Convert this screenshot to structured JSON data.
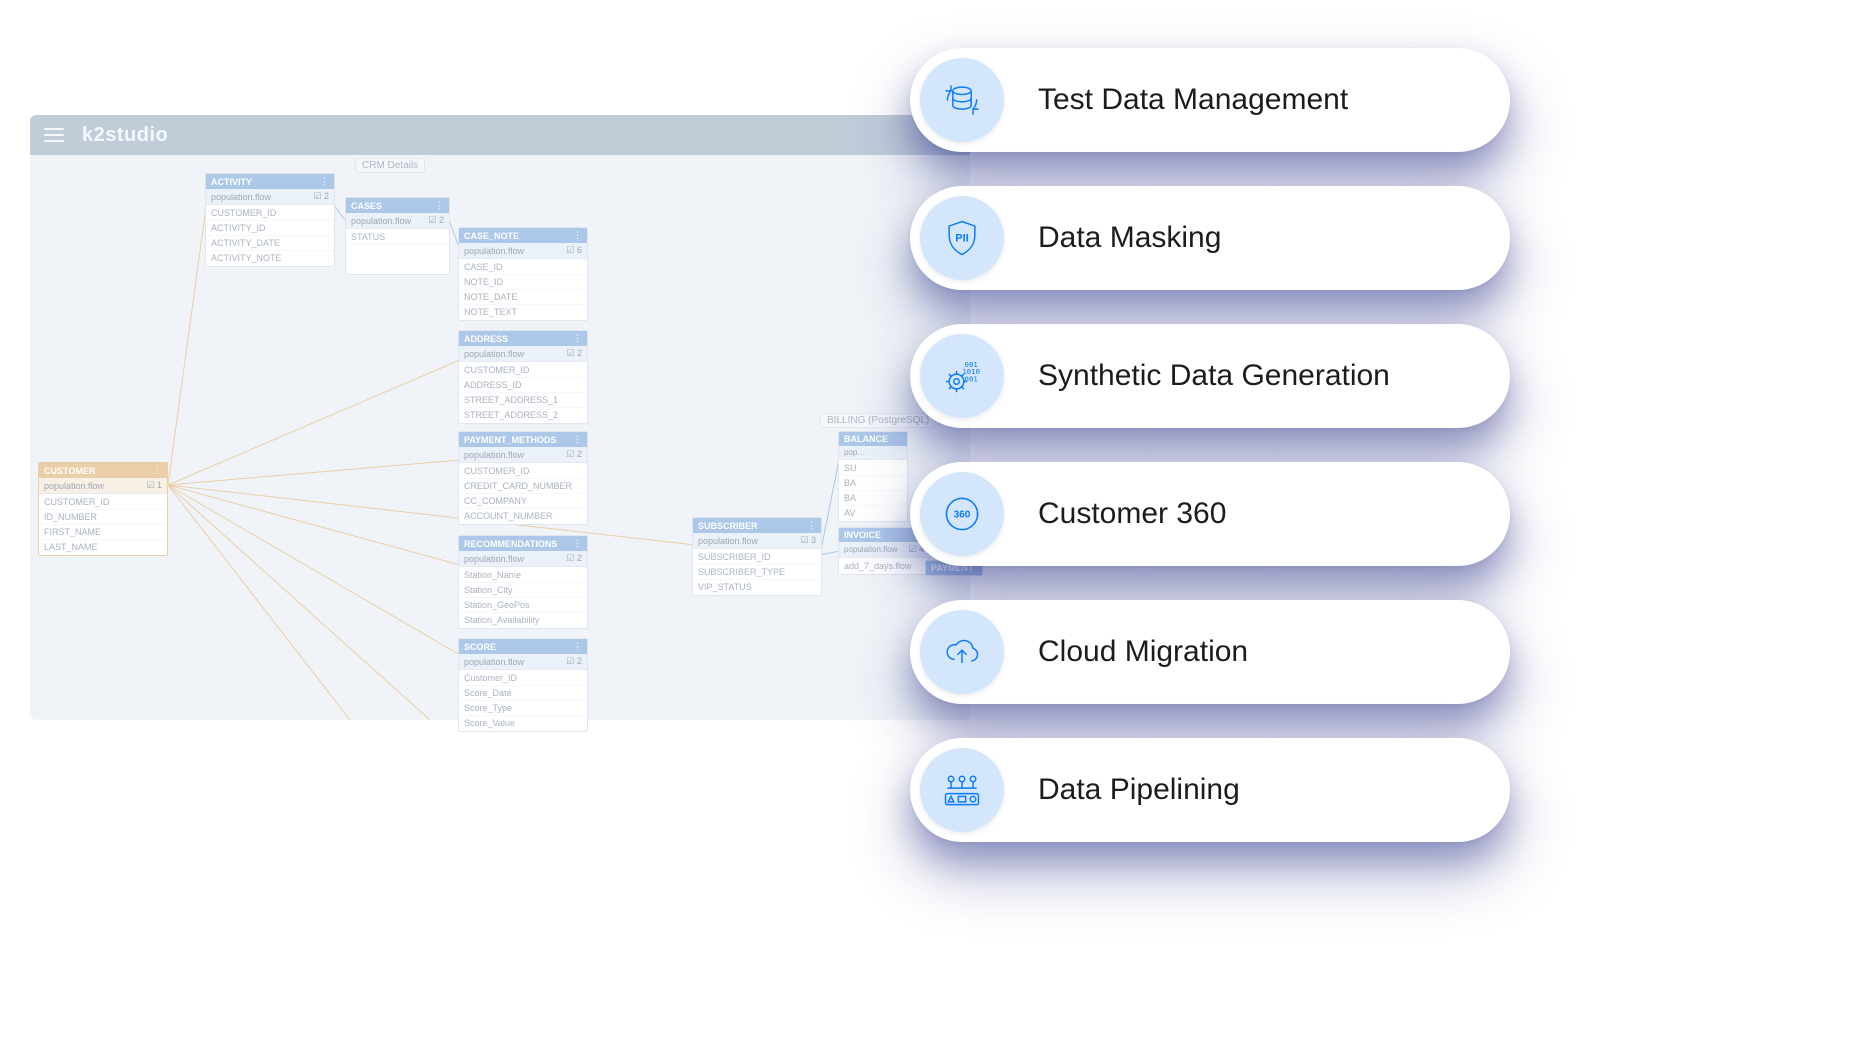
{
  "studio": {
    "logo": "k2studio",
    "canvas_tags": {
      "crm": "CRM Details",
      "billing": "BILLING (PostgreSQL)"
    },
    "population_flow_label": "population.flow",
    "entities": {
      "customer": {
        "title": "CUSTOMER",
        "count": "1",
        "fields": [
          "CUSTOMER_ID",
          "ID_NUMBER",
          "FIRST_NAME",
          "LAST_NAME"
        ]
      },
      "activity": {
        "title": "ACTIVITY",
        "count": "2",
        "fields": [
          "CUSTOMER_ID",
          "ACTIVITY_ID",
          "ACTIVITY_DATE",
          "ACTIVITY_NOTE"
        ]
      },
      "cases": {
        "title": "CASES",
        "count": "2",
        "fields": [
          "STATUS"
        ]
      },
      "case_note": {
        "title": "CASE_NOTE",
        "count": "6",
        "fields": [
          "CASE_ID",
          "NOTE_ID",
          "NOTE_DATE",
          "NOTE_TEXT"
        ]
      },
      "address": {
        "title": "ADDRESS",
        "count": "2",
        "fields": [
          "CUSTOMER_ID",
          "ADDRESS_ID",
          "STREET_ADDRESS_1",
          "STREET_ADDRESS_2"
        ]
      },
      "payment": {
        "title": "PAYMENT_METHODS",
        "count": "2",
        "fields": [
          "CUSTOMER_ID",
          "CREDIT_CARD_NUMBER",
          "CC_COMPANY",
          "ACCOUNT_NUMBER"
        ]
      },
      "recs": {
        "title": "RECOMMENDATIONS",
        "count": "2",
        "fields": [
          "Station_Name",
          "Station_City",
          "Station_GeoPos",
          "Station_Availability"
        ]
      },
      "score": {
        "title": "SCORE",
        "count": "2",
        "fields": [
          "Customer_ID",
          "Score_Date",
          "Score_Type",
          "Score_Value"
        ]
      },
      "subscriber": {
        "title": "SUBSCRIBER",
        "count": "3",
        "fields": [
          "SUBSCRIBER_ID",
          "SUBSCRIBER_TYPE",
          "VIP_STATUS"
        ]
      },
      "balance": {
        "title": "BALANCE",
        "count": "",
        "fields": [
          "SU",
          "BA",
          "BA",
          "AV"
        ]
      },
      "invoice": {
        "title": "INVOICE",
        "count": "4",
        "fields": [
          "add_7_days.flow"
        ]
      },
      "payment2": {
        "title": "PAYMENT",
        "count": "",
        "fields": []
      }
    }
  },
  "features": [
    {
      "icon": "database-sync-icon",
      "label": "Test Data Management"
    },
    {
      "icon": "pii-shield-icon",
      "label": "Data Masking"
    },
    {
      "icon": "binary-gear-icon",
      "label": "Synthetic Data Generation"
    },
    {
      "icon": "c360-icon",
      "label": "Customer 360"
    },
    {
      "icon": "cloud-upload-icon",
      "label": "Cloud Migration"
    },
    {
      "icon": "pipeline-icon",
      "label": "Data Pipelining"
    }
  ]
}
